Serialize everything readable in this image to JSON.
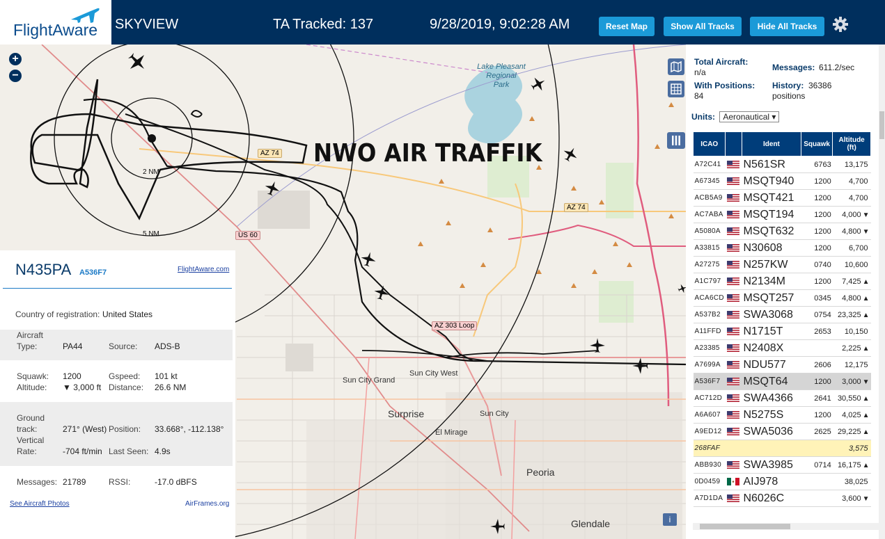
{
  "header": {
    "logo_text": "FlightAware",
    "app_title": "SKYVIEW",
    "tracked": "TA Tracked: 137",
    "datetime": "9/28/2019, 9:02:28 AM",
    "reset_label": "Reset Map",
    "show_label": "Show All Tracks",
    "hide_label": "Hide All Tracks"
  },
  "map": {
    "overlay_text": "NWO AIR TRAFFIK",
    "range_2nm": "2 NM",
    "range_5nm": "5 NM",
    "lake_line1": "Lake Pleasant",
    "lake_line2": "Regional",
    "lake_line3": "Park",
    "highways": {
      "az74a": "AZ 74",
      "az74b": "AZ 74",
      "us60": "US 60",
      "az303": "AZ 303 Loop"
    },
    "places": {
      "sun_city_grand": "Sun City Grand",
      "sun_city_west": "Sun City West",
      "surprise": "Surprise",
      "sun_city": "Sun City",
      "el_mirage": "El Mirage",
      "peoria": "Peoria",
      "glendale": "Glendale"
    },
    "attribution": "i"
  },
  "aircraft": {
    "registration": "N435PA",
    "hex": "A536F7",
    "link_fa": "FlightAware.com",
    "country_label": "Country of registration:",
    "country": "United States",
    "aircraft_type_label1": "Aircraft",
    "aircraft_type_label2": "Type:",
    "aircraft_type": "PA44",
    "source_label": "Source:",
    "source": "ADS-B",
    "squawk_label": "Squawk:",
    "squawk": "1200",
    "gspeed_label": "Gspeed:",
    "gspeed": "101 kt",
    "altitude_label": "Altitude:",
    "altitude": "▼ 3,000 ft",
    "distance_label": "Distance:",
    "distance": "26.6 NM",
    "track_label1": "Ground",
    "track_label2": "track:",
    "track": "271° (West)",
    "position_label": "Position:",
    "position": "33.668°, -112.138°",
    "vrate_label1": "Vertical",
    "vrate_label2": "Rate:",
    "vrate": "-704 ft/min",
    "lastseen_label": "Last Seen:",
    "lastseen": "4.9s",
    "messages_label": "Messages:",
    "messages": "21789",
    "rssi_label": "RSSI:",
    "rssi": "-17.0 dBFS",
    "photos_link": "See Aircraft Photos",
    "airframes_link": "AirFrames.org"
  },
  "stats": {
    "total_label": "Total Aircraft:",
    "total": "n/a",
    "messages_label": "Messages:",
    "messages": "611.2/sec",
    "positions_label": "With Positions:",
    "positions": "84",
    "history_label": "History:",
    "history": "36386",
    "history_unit": "positions",
    "units_label": "Units:",
    "units_value": "Aeronautical ▾"
  },
  "table": {
    "headers": {
      "icao": "ICAO",
      "ident": "Ident",
      "squawk": "Squawk",
      "alt1": "Altitude",
      "alt2": "(ft)"
    },
    "rows": [
      {
        "icao": "A72C41",
        "flag": "us",
        "ident": "N561SR",
        "squawk": "6763",
        "alt": "13,175",
        "trend": ""
      },
      {
        "icao": "A67345",
        "flag": "us",
        "ident": "MSQT940",
        "squawk": "1200",
        "alt": "4,700",
        "trend": ""
      },
      {
        "icao": "ACB5A9",
        "flag": "us",
        "ident": "MSQT421",
        "squawk": "1200",
        "alt": "4,700",
        "trend": ""
      },
      {
        "icao": "AC7ABA",
        "flag": "us",
        "ident": "MSQT194",
        "squawk": "1200",
        "alt": "4,000",
        "trend": "▼"
      },
      {
        "icao": "A5080A",
        "flag": "us",
        "ident": "MSQT632",
        "squawk": "1200",
        "alt": "4,800",
        "trend": "▼"
      },
      {
        "icao": "A33815",
        "flag": "us",
        "ident": "N30608",
        "squawk": "1200",
        "alt": "6,700",
        "trend": ""
      },
      {
        "icao": "A27275",
        "flag": "us",
        "ident": "N257KW",
        "squawk": "0740",
        "alt": "10,600",
        "trend": ""
      },
      {
        "icao": "A1C797",
        "flag": "us",
        "ident": "N2134M",
        "squawk": "1200",
        "alt": "7,425",
        "trend": "▲"
      },
      {
        "icao": "ACA6CD",
        "flag": "us",
        "ident": "MSQT257",
        "squawk": "0345",
        "alt": "4,800",
        "trend": "▲"
      },
      {
        "icao": "A537B2",
        "flag": "us",
        "ident": "SWA3068",
        "squawk": "0754",
        "alt": "23,325",
        "trend": "▲"
      },
      {
        "icao": "A11FFD",
        "flag": "us",
        "ident": "N1715T",
        "squawk": "2653",
        "alt": "10,150",
        "trend": ""
      },
      {
        "icao": "A23385",
        "flag": "us",
        "ident": "N2408X",
        "squawk": "",
        "alt": "2,225",
        "trend": "▲"
      },
      {
        "icao": "A7699A",
        "flag": "us",
        "ident": "NDU577",
        "squawk": "2606",
        "alt": "12,175",
        "trend": ""
      },
      {
        "icao": "A536F7",
        "flag": "us",
        "ident": "MSQT64",
        "squawk": "1200",
        "alt": "3,000",
        "trend": "▼"
      },
      {
        "icao": "AC712D",
        "flag": "us",
        "ident": "SWA4366",
        "squawk": "2641",
        "alt": "30,550",
        "trend": "▲"
      },
      {
        "icao": "A6A607",
        "flag": "us",
        "ident": "N5275S",
        "squawk": "1200",
        "alt": "4,025",
        "trend": "▲"
      },
      {
        "icao": "A9ED12",
        "flag": "us",
        "ident": "SWA5036",
        "squawk": "2625",
        "alt": "29,225",
        "trend": "▲"
      },
      {
        "icao": "268FAF",
        "flag": "",
        "ident": "",
        "squawk": "",
        "alt": "3,575",
        "trend": ""
      },
      {
        "icao": "ABB930",
        "flag": "us",
        "ident": "SWA3985",
        "squawk": "0714",
        "alt": "16,175",
        "trend": "▲"
      },
      {
        "icao": "0D0459",
        "flag": "mx",
        "ident": "AIJ978",
        "squawk": "",
        "alt": "38,025",
        "trend": ""
      },
      {
        "icao": "A7D1DA",
        "flag": "us",
        "ident": "N6026C",
        "squawk": "",
        "alt": "3,600",
        "trend": "▼"
      }
    ]
  },
  "colors": {
    "header": "#002f5d",
    "button": "#1b9ad8",
    "selected_row": "#d5d5d5",
    "highlight_row": "#fff3b8"
  }
}
